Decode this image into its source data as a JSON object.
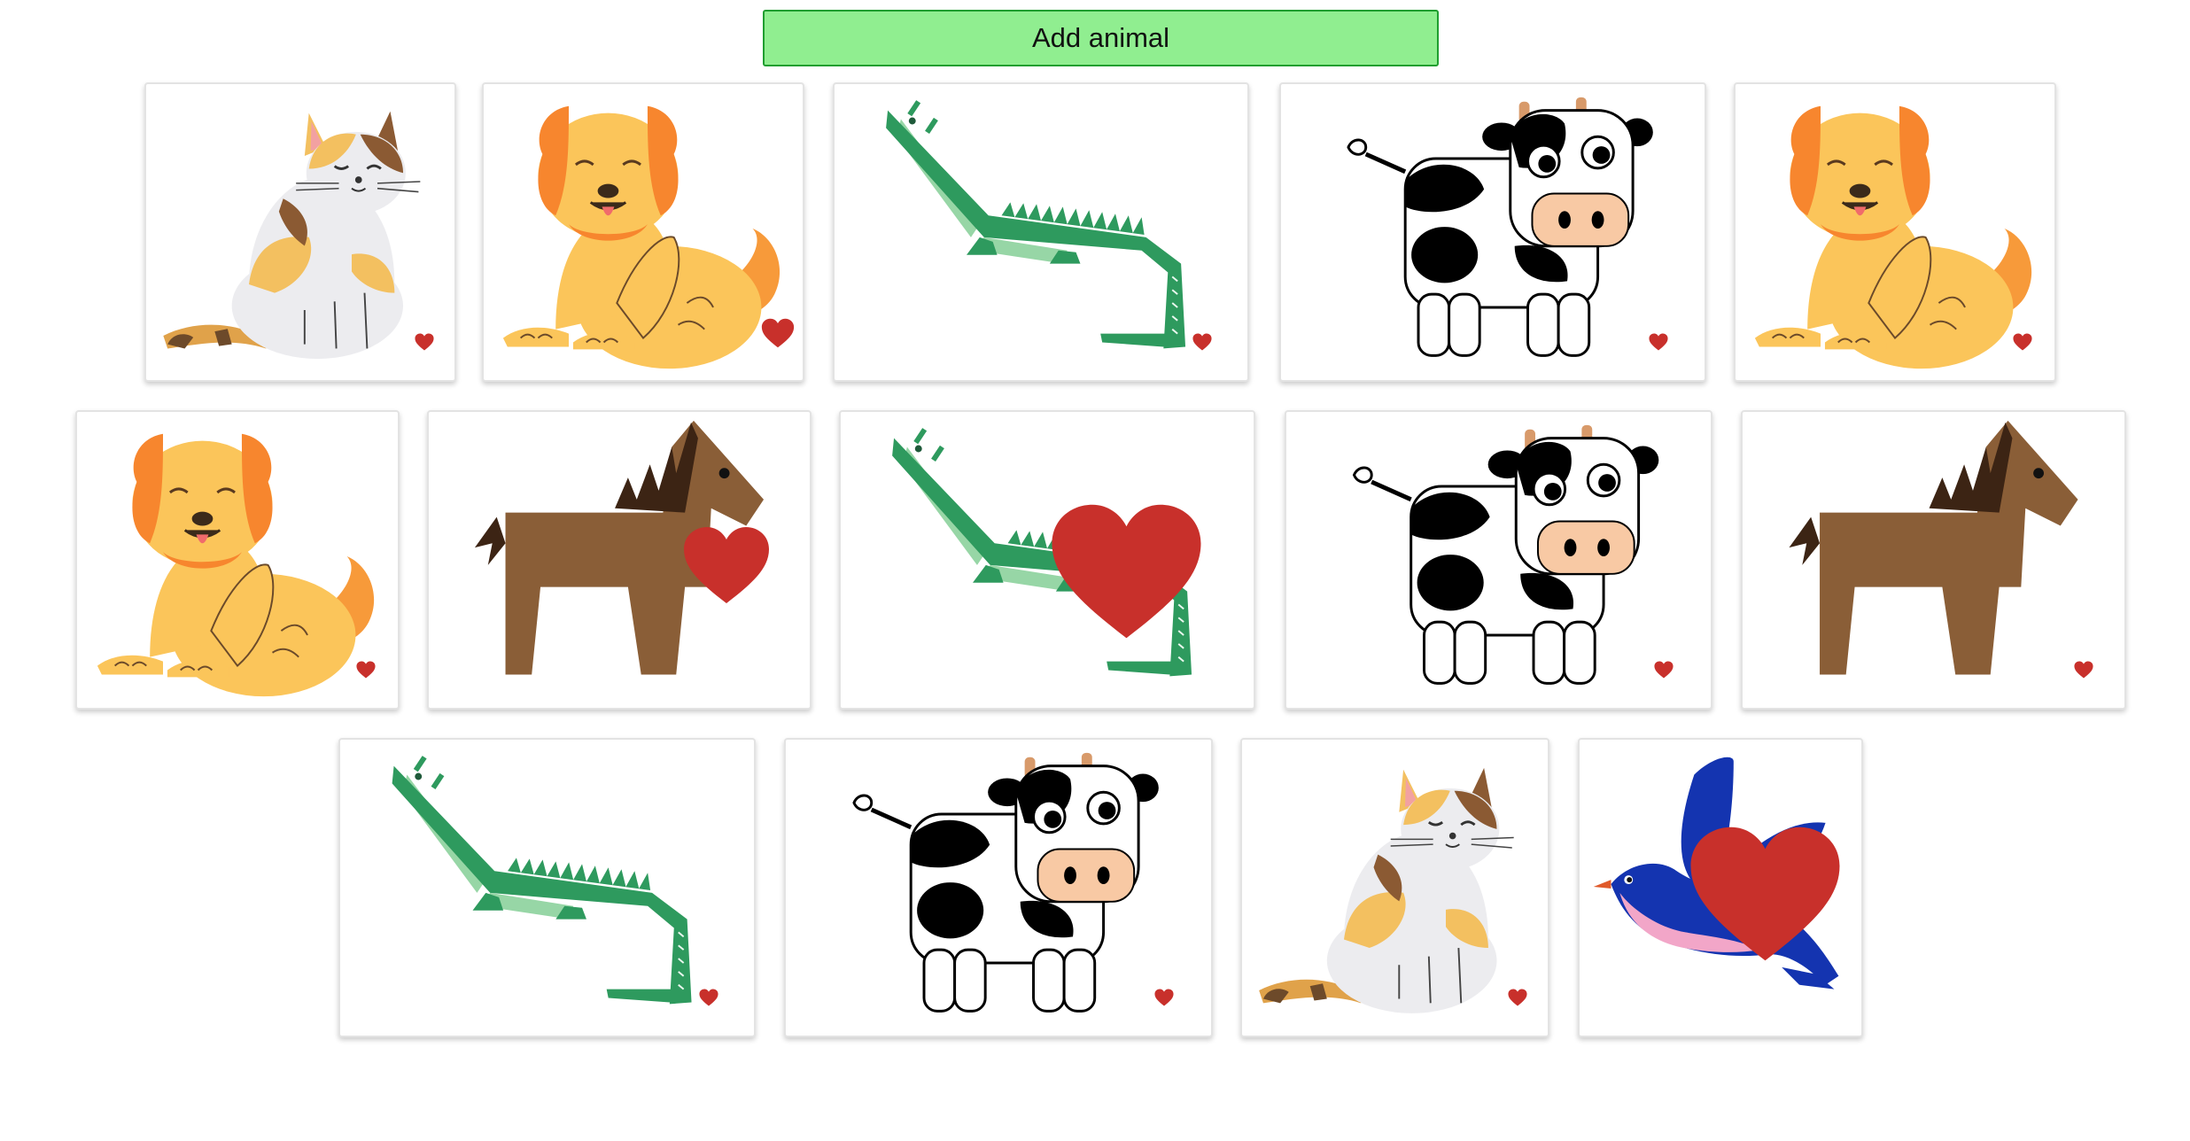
{
  "toolbar": {
    "add_label": "Add animal"
  },
  "colors": {
    "add_button": "#90ee90",
    "heart": "#c8302b"
  },
  "cards": [
    {
      "animal": "cat",
      "icon": "cat-icon",
      "heart_size": "small"
    },
    {
      "animal": "dog",
      "icon": "dog-icon",
      "heart_size": "medium"
    },
    {
      "animal": "crocodile",
      "icon": "crocodile-icon",
      "heart_size": "small"
    },
    {
      "animal": "cow",
      "icon": "cow-icon",
      "heart_size": "small"
    },
    {
      "animal": "dog",
      "icon": "dog-icon",
      "heart_size": "small"
    },
    {
      "animal": "dog",
      "icon": "dog-icon",
      "heart_size": "small"
    },
    {
      "animal": "horse",
      "icon": "horse-icon",
      "heart_size": "large"
    },
    {
      "animal": "crocodile",
      "icon": "crocodile-icon",
      "heart_size": "xlarge"
    },
    {
      "animal": "cow",
      "icon": "cow-icon",
      "heart_size": "small"
    },
    {
      "animal": "horse",
      "icon": "horse-icon",
      "heart_size": "small"
    },
    {
      "animal": "crocodile",
      "icon": "crocodile-icon",
      "heart_size": "small"
    },
    {
      "animal": "cow",
      "icon": "cow-icon",
      "heart_size": "small"
    },
    {
      "animal": "cat",
      "icon": "cat-icon",
      "heart_size": "small"
    },
    {
      "animal": "bird",
      "icon": "bird-icon",
      "heart_size": "xlarge"
    }
  ]
}
